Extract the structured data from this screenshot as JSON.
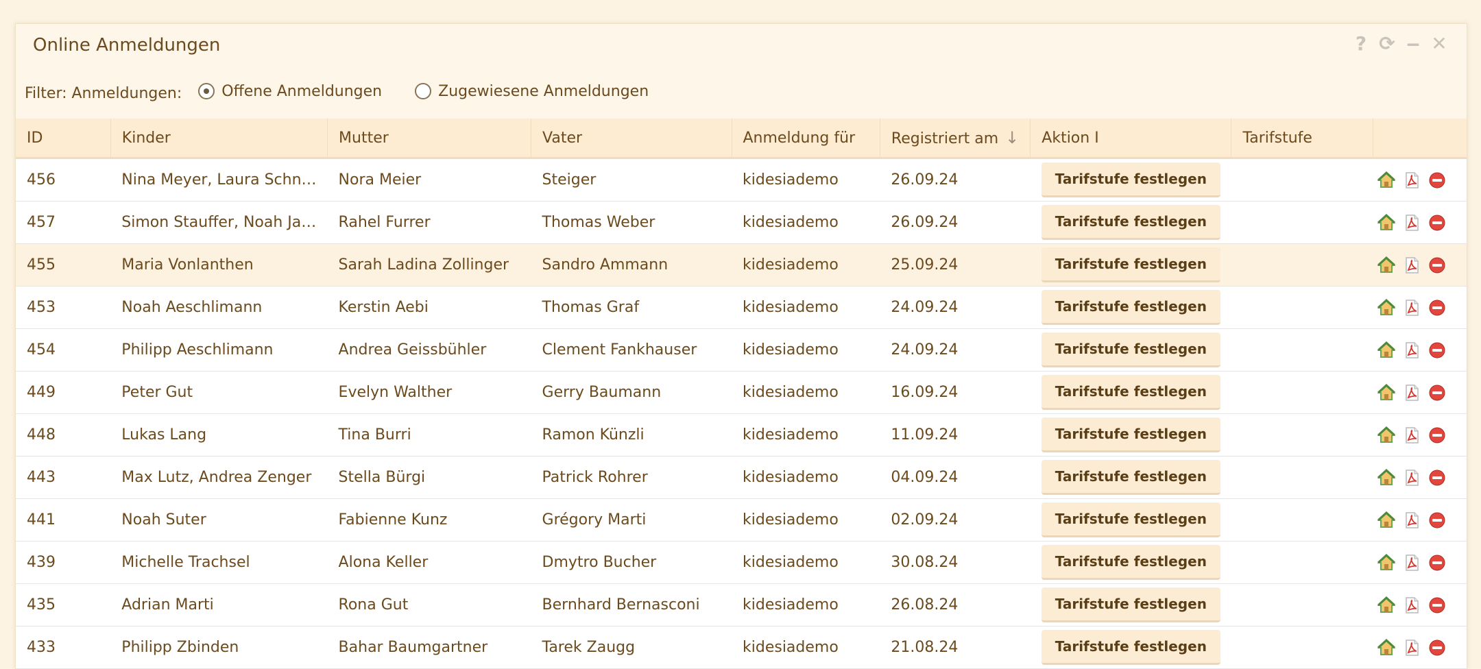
{
  "window": {
    "title": "Online Anmeldungen",
    "controls": [
      "?",
      "⟳",
      "‒",
      "✕"
    ]
  },
  "filter": {
    "label": "Filter: Anmeldungen:",
    "options": [
      {
        "label": "Offene Anmeldungen",
        "selected": true
      },
      {
        "label": "Zugewiesene Anmeldungen",
        "selected": false
      }
    ]
  },
  "table": {
    "columns": [
      "ID",
      "Kinder",
      "Mutter",
      "Vater",
      "Anmeldung für",
      "Registriert am",
      "Aktion I",
      "Tarifstufe",
      ""
    ],
    "action_label": "Tarifstufe festlegen",
    "rows": [
      {
        "id": "456",
        "kinder": "Nina Meyer, Laura Schn…",
        "mutter": "Nora Meier",
        "vater": "Steiger",
        "fuer": "kidesiademo",
        "datum": "26.09.24",
        "tarif": ""
      },
      {
        "id": "457",
        "kinder": "Simon Stauffer, Noah Ja…",
        "mutter": "Rahel Furrer",
        "vater": "Thomas Weber",
        "fuer": "kidesiademo",
        "datum": "26.09.24",
        "tarif": ""
      },
      {
        "id": "455",
        "kinder": "Maria Vonlanthen",
        "mutter": "Sarah Ladina Zollinger",
        "vater": "Sandro Ammann",
        "fuer": "kidesiademo",
        "datum": "25.09.24",
        "tarif": ""
      },
      {
        "id": "453",
        "kinder": "Noah Aeschlimann",
        "mutter": "Kerstin Aebi",
        "vater": "Thomas Graf",
        "fuer": "kidesiademo",
        "datum": "24.09.24",
        "tarif": ""
      },
      {
        "id": "454",
        "kinder": "Philipp Aeschlimann",
        "mutter": "Andrea Geissbühler",
        "vater": "Clement Fankhauser",
        "fuer": "kidesiademo",
        "datum": "24.09.24",
        "tarif": ""
      },
      {
        "id": "449",
        "kinder": "Peter Gut",
        "mutter": "Evelyn Walther",
        "vater": "Gerry Baumann",
        "fuer": "kidesiademo",
        "datum": "16.09.24",
        "tarif": ""
      },
      {
        "id": "448",
        "kinder": "Lukas Lang",
        "mutter": "Tina Burri",
        "vater": "Ramon Künzli",
        "fuer": "kidesiademo",
        "datum": "11.09.24",
        "tarif": ""
      },
      {
        "id": "443",
        "kinder": "Max Lutz, Andrea Zenger",
        "mutter": "Stella Bürgi",
        "vater": "Patrick Rohrer",
        "fuer": "kidesiademo",
        "datum": "04.09.24",
        "tarif": ""
      },
      {
        "id": "441",
        "kinder": "Noah Suter",
        "mutter": "Fabienne Kunz",
        "vater": "Grégory Marti",
        "fuer": "kidesiademo",
        "datum": "02.09.24",
        "tarif": ""
      },
      {
        "id": "439",
        "kinder": "Michelle Trachsel",
        "mutter": "Alona Keller",
        "vater": "Dmytro Bucher",
        "fuer": "kidesiademo",
        "datum": "30.08.24",
        "tarif": ""
      },
      {
        "id": "435",
        "kinder": "Adrian Marti",
        "mutter": "Rona Gut",
        "vater": "Bernhard Bernasconi",
        "fuer": "kidesiademo",
        "datum": "26.08.24",
        "tarif": ""
      },
      {
        "id": "433",
        "kinder": "Philipp Zbinden",
        "mutter": "Bahar Baumgartner",
        "vater": "Tarek Zaugg",
        "fuer": "kidesiademo",
        "datum": "21.08.24",
        "tarif": ""
      }
    ],
    "highlighted_row": 2,
    "row_icons": [
      "home-icon",
      "pdf-icon",
      "delete-icon"
    ]
  },
  "colors": {
    "background": "#fdf3e3",
    "header": "#fdebd2",
    "text": "#6b4a1e",
    "delete": "#e2473f",
    "home": "#6aa84f",
    "pdf": "#d9342b"
  }
}
